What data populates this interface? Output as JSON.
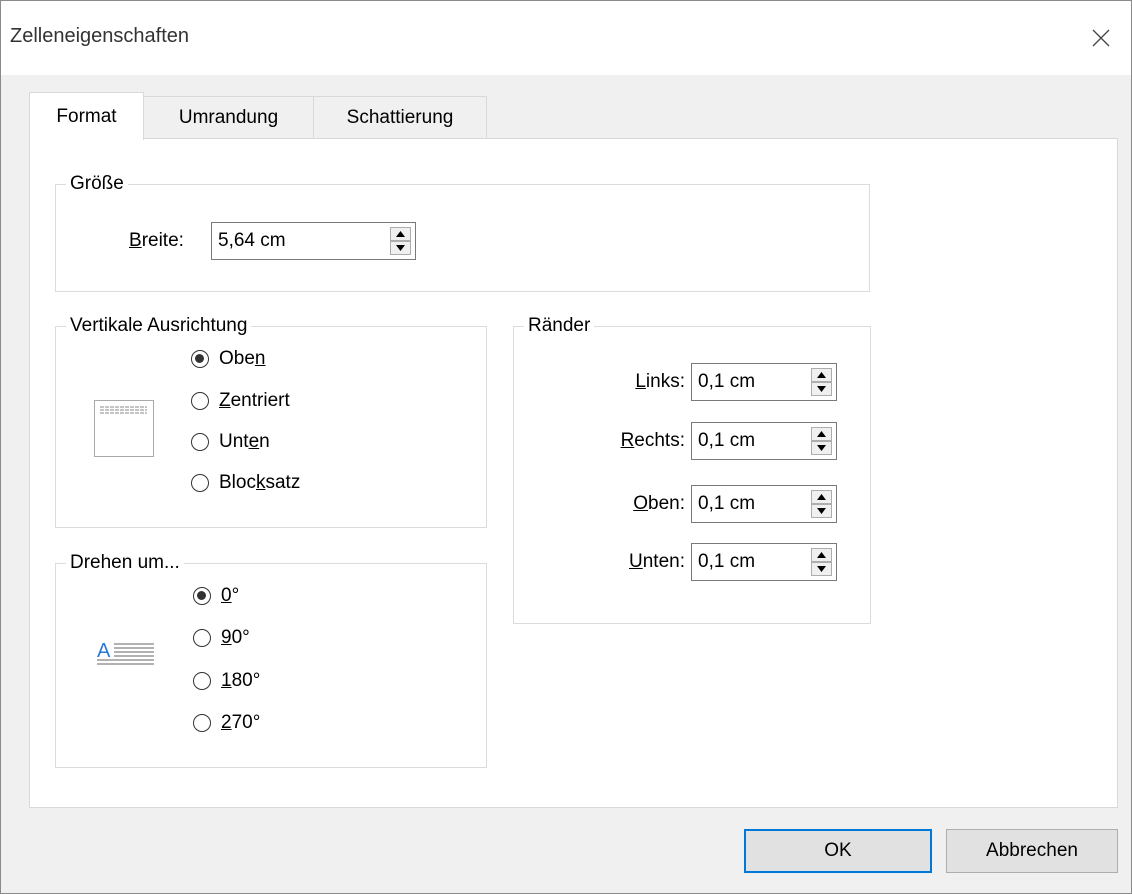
{
  "window": {
    "title": "Zelleneigenschaften"
  },
  "tabs": [
    {
      "label": "Format",
      "active": true
    },
    {
      "label": "Umrandung",
      "active": false
    },
    {
      "label": "Schattierung",
      "active": false
    }
  ],
  "groesse": {
    "legend": "Größe",
    "breite_label_u": "B",
    "breite_label_rest": "reite:",
    "breite_value": "5,64 cm"
  },
  "vertikal": {
    "legend": "Vertikale Ausrichtung",
    "options": [
      {
        "pre": "Obe",
        "u": "n",
        "post": "",
        "checked": true
      },
      {
        "pre": "",
        "u": "Z",
        "post": "entriert",
        "checked": false
      },
      {
        "pre": "Unt",
        "u": "e",
        "post": "n",
        "checked": false
      },
      {
        "pre": "Bloc",
        "u": "k",
        "post": "satz",
        "checked": false
      }
    ]
  },
  "raender": {
    "legend": "Ränder",
    "fields": [
      {
        "u": "L",
        "rest": "inks:",
        "value": "0,1 cm"
      },
      {
        "u": "R",
        "rest": "echts:",
        "value": "0,1 cm"
      },
      {
        "u": "O",
        "rest": "ben:",
        "value": "0,1 cm"
      },
      {
        "u": "U",
        "rest": "nten:",
        "value": "0,1 cm"
      }
    ]
  },
  "drehen": {
    "legend": "Drehen um...",
    "options": [
      {
        "u": "0",
        "post": "°",
        "checked": true
      },
      {
        "u": "9",
        "post": "0°",
        "checked": false
      },
      {
        "u": "1",
        "post": "80°",
        "checked": false
      },
      {
        "u": "2",
        "post": "70°",
        "checked": false
      }
    ],
    "preview_letter": "A"
  },
  "buttons": {
    "ok": "OK",
    "cancel": "Abbrechen"
  },
  "colors": {
    "accent": "#0078d7",
    "preview_letter": "#2b79d4"
  },
  "icons": [
    "close-icon",
    "spin-up-icon",
    "spin-down-icon",
    "valign-preview-icon",
    "rotation-preview-icon"
  ]
}
